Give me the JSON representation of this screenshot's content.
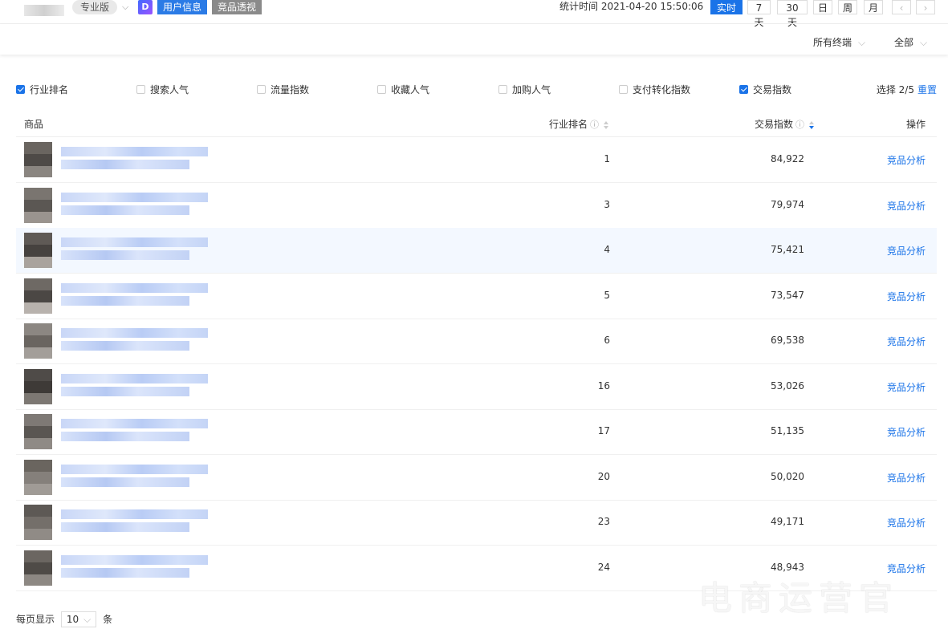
{
  "header": {
    "edition": "专业版",
    "brand_glyph": "D",
    "tabs": [
      "用户信息",
      "竞品透视"
    ],
    "stat_time": "统计时间 2021-04-20 15:50:06",
    "range_buttons": [
      "实时",
      "7天",
      "30天",
      "日",
      "周",
      "月"
    ],
    "active_range": "实时",
    "prev": "‹",
    "next": "›"
  },
  "filters": {
    "terminal": "所有终端",
    "scope": "全部"
  },
  "metrics": [
    {
      "label": "行业排名",
      "checked": true
    },
    {
      "label": "搜索人气",
      "checked": false
    },
    {
      "label": "流量指数",
      "checked": false
    },
    {
      "label": "收藏人气",
      "checked": false
    },
    {
      "label": "加购人气",
      "checked": false
    },
    {
      "label": "支付转化指数",
      "checked": false
    },
    {
      "label": "交易指数",
      "checked": true
    }
  ],
  "selection": {
    "count": "选择 2/5",
    "reset": "重置"
  },
  "table": {
    "columns": {
      "product": "商品",
      "rank": "行业排名",
      "index": "交易指数",
      "action": "操作"
    },
    "rows": [
      {
        "rank": "1",
        "index": "84,922",
        "action": "竞品分析"
      },
      {
        "rank": "3",
        "index": "79,974",
        "action": "竞品分析"
      },
      {
        "rank": "4",
        "index": "75,421",
        "action": "竞品分析"
      },
      {
        "rank": "5",
        "index": "73,547",
        "action": "竞品分析"
      },
      {
        "rank": "6",
        "index": "69,538",
        "action": "竞品分析"
      },
      {
        "rank": "16",
        "index": "53,026",
        "action": "竞品分析"
      },
      {
        "rank": "17",
        "index": "51,135",
        "action": "竞品分析"
      },
      {
        "rank": "20",
        "index": "50,020",
        "action": "竞品分析"
      },
      {
        "rank": "23",
        "index": "49,171",
        "action": "竞品分析"
      },
      {
        "rank": "24",
        "index": "48,943",
        "action": "竞品分析"
      }
    ]
  },
  "pager": {
    "prefix": "每页显示",
    "size": "10",
    "suffix": "条"
  },
  "watermark": "电商运营官",
  "colors": {
    "accent": "#1a73e8",
    "tag_blue": "#2b7be6",
    "tag_gray": "#8a8a8a"
  }
}
